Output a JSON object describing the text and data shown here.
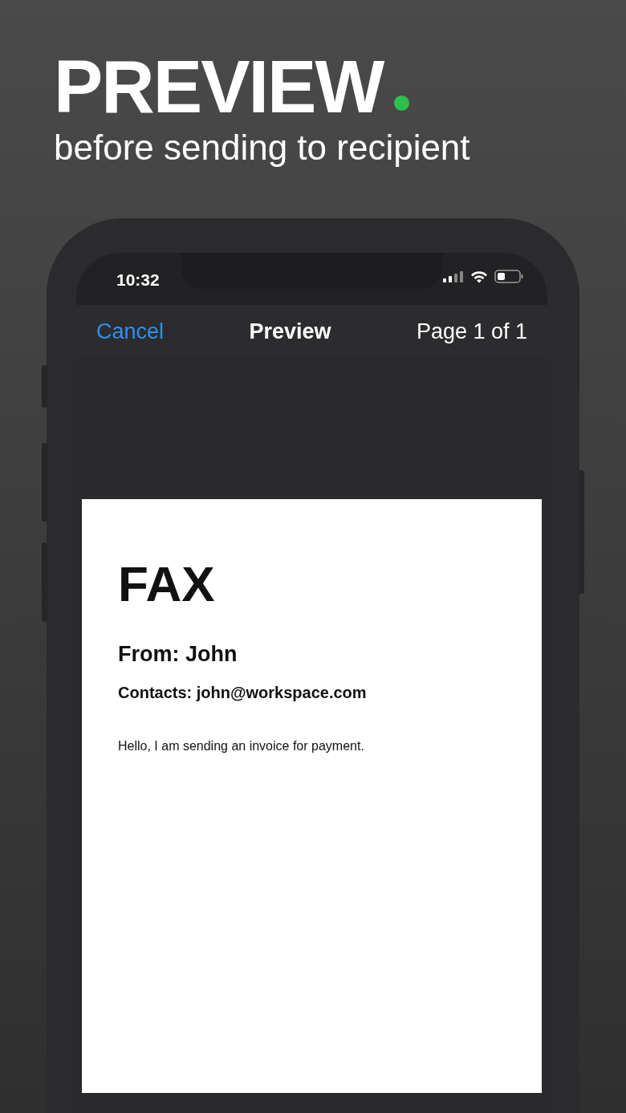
{
  "headline": {
    "title": "PREVIEW",
    "subtitle": "before sending to recipient"
  },
  "status_bar": {
    "time": "10:32"
  },
  "nav_bar": {
    "cancel": "Cancel",
    "title": "Preview",
    "page_indicator": "Page 1 of 1"
  },
  "document": {
    "title": "FAX",
    "from": "From: John",
    "contacts": "Contacts: john@workspace.com",
    "body": "Hello, I am sending an invoice for payment."
  }
}
